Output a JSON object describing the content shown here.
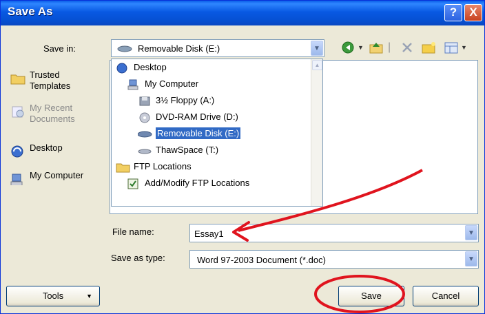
{
  "window": {
    "title": "Save As",
    "help_label": "?",
    "close_label": "X"
  },
  "save_in": {
    "label": "Save in:",
    "value": "Removable Disk (E:)"
  },
  "places": [
    {
      "label": "Trusted Templates",
      "icon": "folder-icon",
      "enabled": true
    },
    {
      "label": "My Recent Documents",
      "icon": "recent-documents-icon",
      "enabled": false
    },
    {
      "label": "Desktop",
      "icon": "desktop-icon",
      "enabled": true
    },
    {
      "label": "My Computer",
      "icon": "computer-icon",
      "enabled": true
    }
  ],
  "locations": [
    {
      "label": "Desktop",
      "icon": "desktop-icon",
      "selected": false
    },
    {
      "label": "My Computer",
      "icon": "computer-icon",
      "selected": false
    },
    {
      "label": "3½ Floppy (A:)",
      "icon": "floppy-drive-icon",
      "selected": false
    },
    {
      "label": "DVD-RAM Drive (D:)",
      "icon": "dvd-drive-icon",
      "selected": false
    },
    {
      "label": "Removable Disk (E:)",
      "icon": "removable-disk-icon",
      "selected": true
    },
    {
      "label": "ThawSpace (T:)",
      "icon": "disk-drive-icon",
      "selected": false
    },
    {
      "label": "FTP Locations",
      "icon": "folder-icon",
      "selected": false
    },
    {
      "label": "Add/Modify FTP Locations",
      "icon": "add-ftp-icon",
      "selected": false
    }
  ],
  "file_name": {
    "label": "File name:",
    "value": "Essay1"
  },
  "save_as_type": {
    "label": "Save as type:",
    "value": "Word 97-2003 Document (*.doc)"
  },
  "buttons": {
    "tools": "Tools",
    "save": "Save",
    "cancel": "Cancel"
  },
  "colors": {
    "titlebar": "#0a5ee8",
    "selection": "#316ac5",
    "annotation": "#e0141e",
    "dialog_bg": "#ece9d8"
  }
}
